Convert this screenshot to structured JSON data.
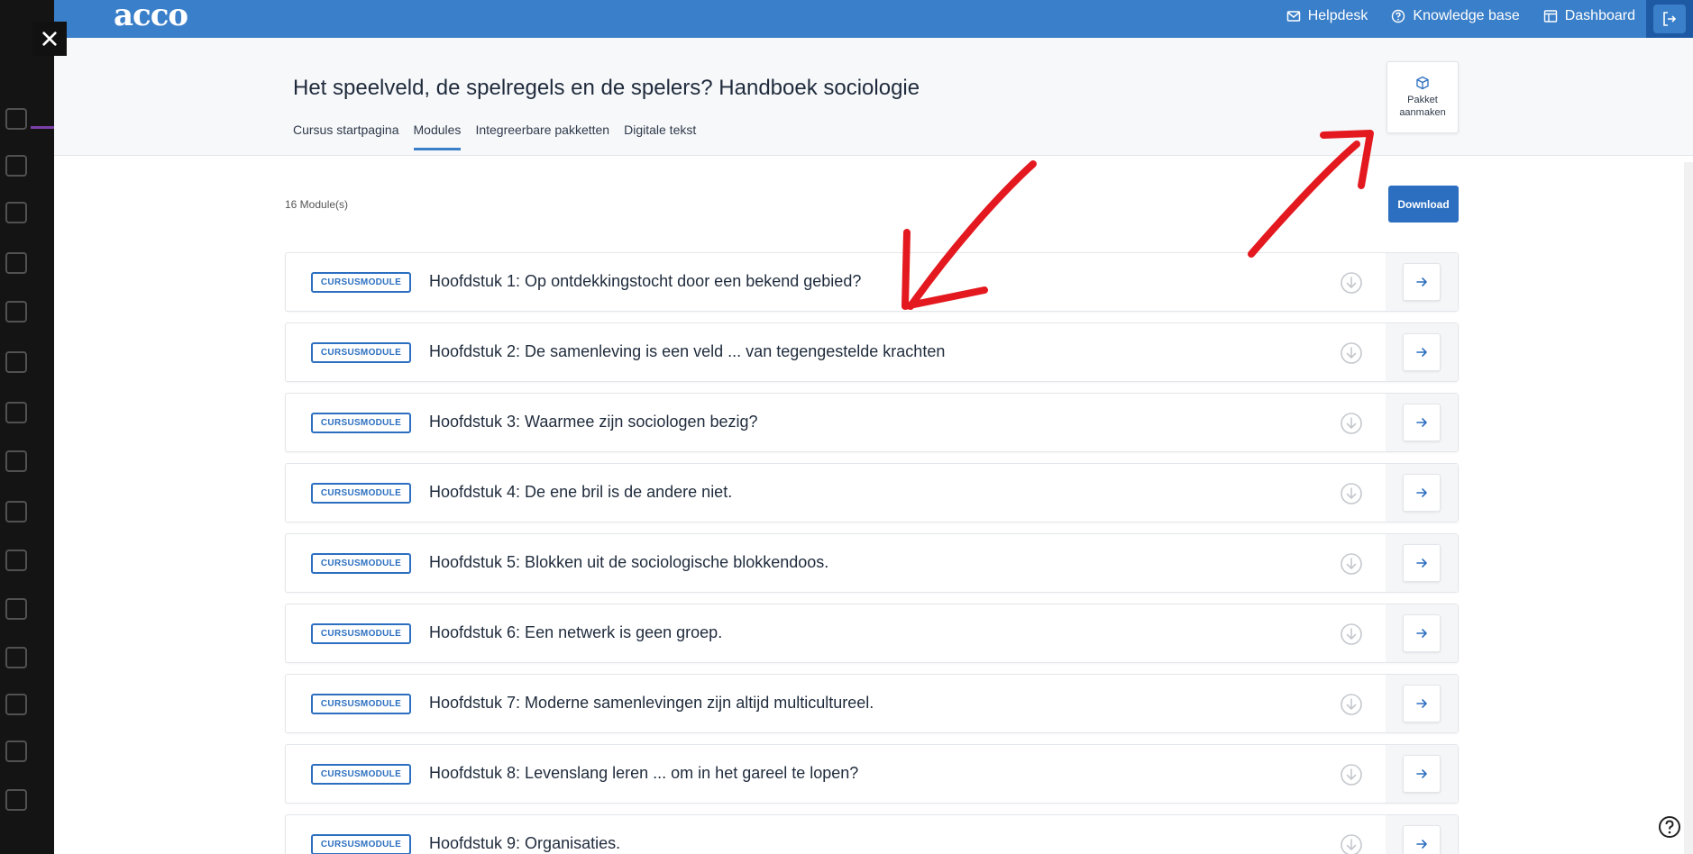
{
  "brand": {
    "logo": "acco",
    "accent": "#3a7fc9",
    "primary_button": "#2c6fc0"
  },
  "nav": {
    "helpdesk": "Helpdesk",
    "knowledge_base": "Knowledge base",
    "dashboard": "Dashboard"
  },
  "course": {
    "title": "Het speelveld, de spelregels en de spelers? Handboek sociologie",
    "tabs": [
      "Cursus startpagina",
      "Modules",
      "Integreerbare pakketten",
      "Digitale tekst"
    ],
    "active_tab": "Modules",
    "package_button": {
      "line1": "Pakket",
      "line2": "aanmaken"
    }
  },
  "content": {
    "count": "16 Module(s)",
    "download_label": "Download",
    "modules": [
      {
        "badge": "CURSUSMODULE",
        "title": "Hoofdstuk 1: Op ontdekkingstocht door een bekend gebied?"
      },
      {
        "badge": "CURSUSMODULE",
        "title": "Hoofdstuk 2: De samenleving is een veld ... van tegengestelde krachten"
      },
      {
        "badge": "CURSUSMODULE",
        "title": "Hoofdstuk 3: Waarmee zijn sociologen bezig?"
      },
      {
        "badge": "CURSUSMODULE",
        "title": "Hoofdstuk 4: De ene bril is de andere niet."
      },
      {
        "badge": "CURSUSMODULE",
        "title": "Hoofdstuk 5: Blokken uit de sociologische blokkendoos."
      },
      {
        "badge": "CURSUSMODULE",
        "title": "Hoofdstuk 6: Een netwerk is geen groep."
      },
      {
        "badge": "CURSUSMODULE",
        "title": "Hoofdstuk 7: Moderne samenlevingen zijn altijd multicultureel."
      },
      {
        "badge": "CURSUSMODULE",
        "title": "Hoofdstuk 8: Levenslang leren ... om in het gareel te lopen?"
      },
      {
        "badge": "CURSUSMODULE",
        "title": "Hoofdstuk 9: Organisaties."
      }
    ]
  }
}
